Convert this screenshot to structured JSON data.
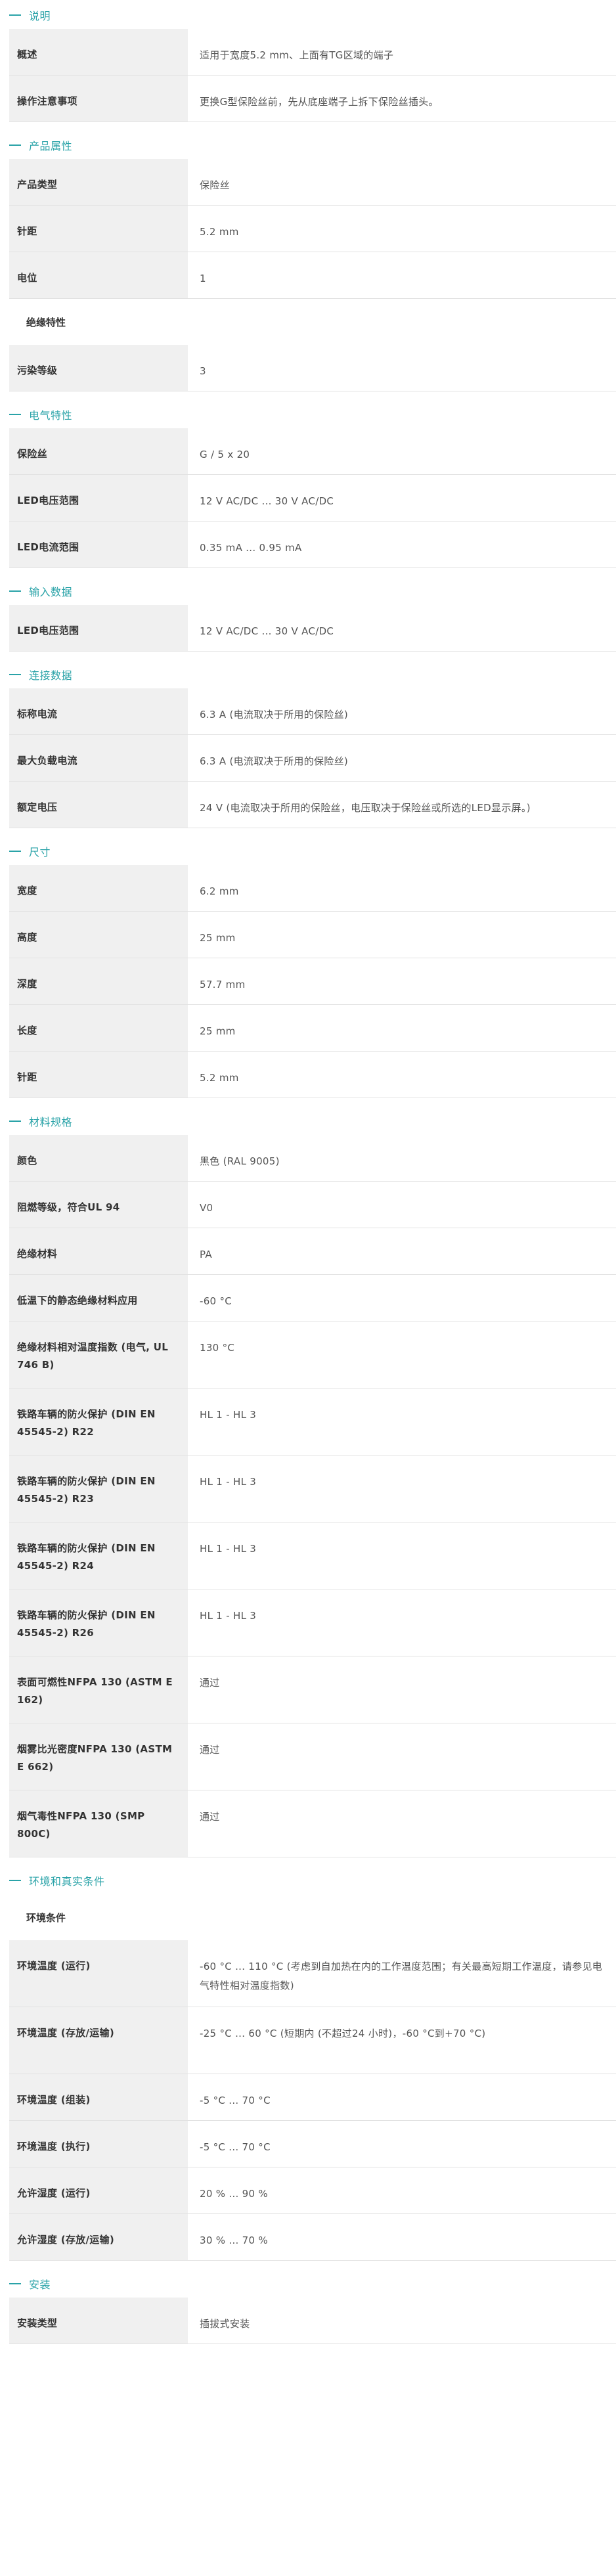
{
  "sections": [
    {
      "title": "说明",
      "rows": [
        {
          "key": "概述",
          "value": "适用于宽度5.2 mm、上面有TG区域的端子"
        },
        {
          "key": "操作注意事项",
          "value": "更换G型保险丝前，先从底座端子上拆下保险丝插头。"
        }
      ]
    },
    {
      "title": "产品属性",
      "rows": [
        {
          "key": "产品类型",
          "value": "保险丝"
        },
        {
          "key": "针距",
          "value": "5.2 mm"
        },
        {
          "key": "电位",
          "value": "1"
        }
      ],
      "subheading": "绝缘特性",
      "rows2": [
        {
          "key": "污染等级",
          "value": "3"
        }
      ]
    },
    {
      "title": "电气特性",
      "rows": [
        {
          "key": "保险丝",
          "value": "G / 5 x 20"
        },
        {
          "key": "LED电压范围",
          "value": "12 V AC/DC ... 30 V AC/DC"
        },
        {
          "key": "LED电流范围",
          "value": "0.35 mA ... 0.95 mA"
        }
      ]
    },
    {
      "title": "输入数据",
      "rows": [
        {
          "key": "LED电压范围",
          "value": "12 V AC/DC ... 30 V AC/DC"
        }
      ]
    },
    {
      "title": "连接数据",
      "rows": [
        {
          "key": "标称电流",
          "value": "6.3 A (电流取决于所用的保险丝)"
        },
        {
          "key": "最大负载电流",
          "value": "6.3 A (电流取决于所用的保险丝)"
        },
        {
          "key": "额定电压",
          "value": "24 V (电流取决于所用的保险丝，电压取决于保险丝或所选的LED显示屏。)"
        }
      ]
    },
    {
      "title": "尺寸",
      "rows": [
        {
          "key": "宽度",
          "value": "6.2 mm"
        },
        {
          "key": "高度",
          "value": "25 mm"
        },
        {
          "key": "深度",
          "value": "57.7 mm"
        },
        {
          "key": "长度",
          "value": "25 mm"
        },
        {
          "key": "针距",
          "value": "5.2 mm"
        }
      ]
    },
    {
      "title": "材料规格",
      "rows": [
        {
          "key": "颜色",
          "value": "黑色 (RAL 9005)"
        },
        {
          "key": "阻燃等级，符合UL 94",
          "value": "V0"
        },
        {
          "key": "绝缘材料",
          "value": "PA"
        },
        {
          "key": "低温下的静态绝缘材料应用",
          "value": "-60 °C"
        },
        {
          "key": "绝缘材料相对温度指数 (电气, UL 746 B)",
          "value": "130 °C"
        },
        {
          "key": "铁路车辆的防火保护 (DIN EN 45545-2) R22",
          "value": "HL 1 - HL 3"
        },
        {
          "key": "铁路车辆的防火保护 (DIN EN 45545-2) R23",
          "value": "HL 1 - HL 3"
        },
        {
          "key": "铁路车辆的防火保护 (DIN EN 45545-2) R24",
          "value": "HL 1 - HL 3"
        },
        {
          "key": "铁路车辆的防火保护 (DIN EN 45545-2) R26",
          "value": "HL 1 - HL 3"
        },
        {
          "key": "表面可燃性NFPA 130 (ASTM E 162)",
          "value": "通过"
        },
        {
          "key": "烟雾比光密度NFPA 130 (ASTM E 662)",
          "value": "通过"
        },
        {
          "key": "烟气毒性NFPA 130 (SMP 800C)",
          "value": "通过"
        }
      ]
    },
    {
      "title": "环境和真实条件",
      "subheading": "环境条件",
      "rows2": [
        {
          "key": "环境温度 (运行)",
          "value": "-60 °C ... 110 °C (考虑到自加热在内的工作温度范围；有关最高短期工作温度，请参见电气特性相对温度指数)"
        },
        {
          "key": "环境温度 (存放/运输)",
          "value": "-25 °C ... 60 °C (短期内 (不超过24 小时)，-60 °C到+70 °C)"
        },
        {
          "key": "环境温度 (组装)",
          "value": "-5 °C ... 70 °C"
        },
        {
          "key": "环境温度 (执行)",
          "value": "-5 °C ... 70 °C"
        },
        {
          "key": "允许湿度 (运行)",
          "value": "20 % ... 90 %"
        },
        {
          "key": "允许湿度 (存放/运输)",
          "value": "30 % ... 70 %"
        }
      ]
    },
    {
      "title": "安装",
      "rows": [
        {
          "key": "安装类型",
          "value": "插拔式安装"
        }
      ]
    }
  ]
}
